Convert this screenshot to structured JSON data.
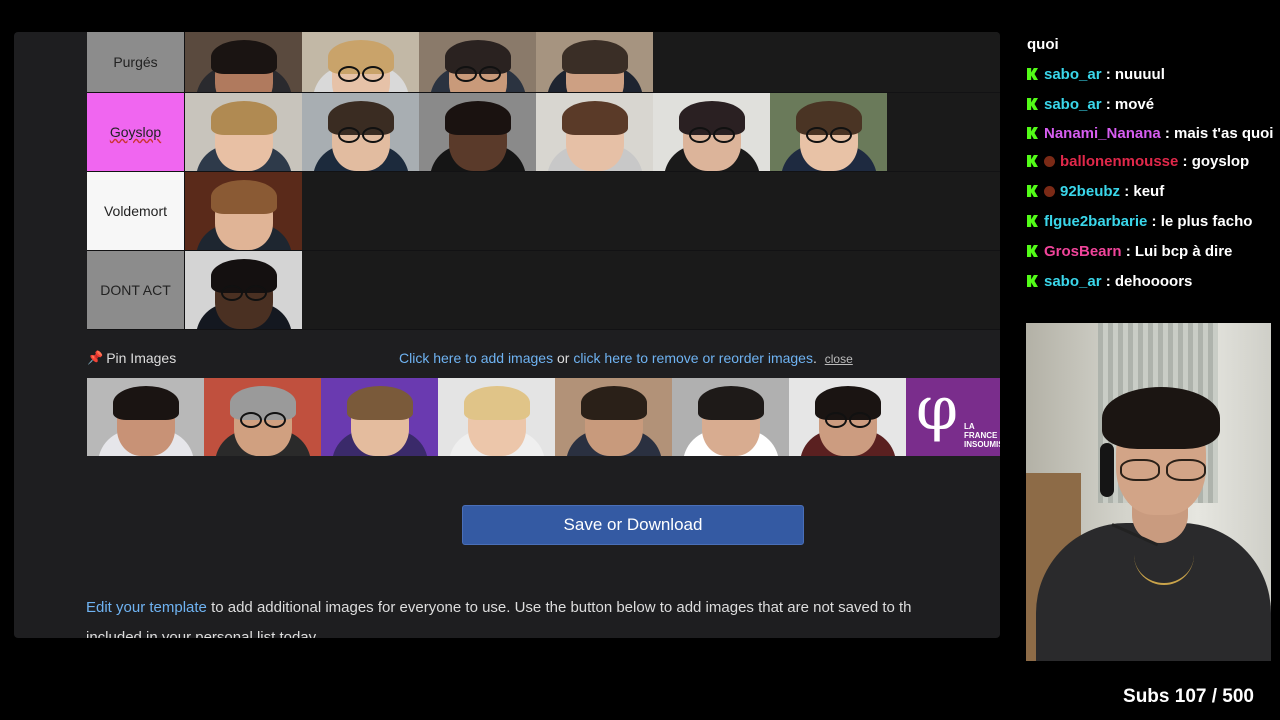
{
  "tiers": [
    {
      "label": "Purgés",
      "color": "#8c8c8c",
      "images": [
        {
          "skin": "#b07a5e",
          "hair": "#1a1412",
          "shirt": "#2a2a2e",
          "bg": "#5a4a3e",
          "glasses": false
        },
        {
          "skin": "#e6c2a8",
          "hair": "#c9a36a",
          "shirt": "#d9d9d9",
          "bg": "#c2b8a6",
          "glasses": true
        },
        {
          "skin": "#c99a7a",
          "hair": "#2a2220",
          "shirt": "#2b3340",
          "bg": "#8a7a6a",
          "glasses": true
        },
        {
          "skin": "#cda083",
          "hair": "#3a2e26",
          "shirt": "#1e2430",
          "bg": "#a69480",
          "glasses": false
        }
      ]
    },
    {
      "label": "Goyslop",
      "color": "#f066f0",
      "images": [
        {
          "skin": "#e8c0a4",
          "hair": "#b08a52",
          "shirt": "#2e3a4a",
          "bg": "#c8c4bc",
          "glasses": false
        },
        {
          "skin": "#e2bca0",
          "hair": "#3a2c22",
          "shirt": "#1c2a3c",
          "bg": "#a8aeb2",
          "glasses": true
        },
        {
          "skin": "#5a3a2a",
          "hair": "#1a1210",
          "shirt": "#151515",
          "bg": "#8a8a8a",
          "glasses": false
        },
        {
          "skin": "#e6c0a6",
          "hair": "#5a3a28",
          "shirt": "#c8c8c8",
          "bg": "#d8d6d0",
          "glasses": false
        },
        {
          "skin": "#dcb49a",
          "hair": "#2a2022",
          "shirt": "#1a1a1a",
          "bg": "#e0e0dc",
          "glasses": true
        },
        {
          "skin": "#e8c2a6",
          "hair": "#4a3424",
          "shirt": "#1e2a40",
          "bg": "#6a7a5a",
          "glasses": true
        }
      ]
    },
    {
      "label": "Voldemort",
      "color": "#f7f7f7",
      "images": [
        {
          "skin": "#e0b496",
          "hair": "#8a5a34",
          "shirt": "#1e2630",
          "bg": "#5a2a1a",
          "glasses": false
        }
      ]
    },
    {
      "label": "DONT ACT",
      "color": "#8c8c8c",
      "images": [
        {
          "skin": "#4a3022",
          "hair": "#141010",
          "shirt": "#141820",
          "bg": "#d4d4d4",
          "glasses": true
        }
      ]
    }
  ],
  "pin_bar": {
    "label": "Pin Images",
    "link_add": "Click here to add images",
    "or": "or",
    "link_remove": "click here to remove or reorder images",
    "period": ".",
    "close": "close"
  },
  "pinned_images": [
    {
      "skin": "#c89276",
      "hair": "#1a1412",
      "shirt": "#e6e6ea",
      "bg": "#b8b8b8",
      "glasses": false
    },
    {
      "skin": "#d0a080",
      "hair": "#9a9a9a",
      "shirt": "#2a2a2a",
      "bg": "#c0503e",
      "glasses": true
    },
    {
      "skin": "#e4bc9e",
      "hair": "#7a5a3a",
      "shirt": "#3a2a6a",
      "bg": "#6a3ab0",
      "glasses": false
    },
    {
      "skin": "#ecc6aa",
      "hair": "#e0c488",
      "shirt": "#efefef",
      "bg": "#e4e4e4",
      "glasses": false
    },
    {
      "skin": "#c89a7c",
      "hair": "#2a2018",
      "shirt": "#2a3040",
      "bg": "#b29278",
      "glasses": false
    },
    {
      "skin": "#d8ac90",
      "hair": "#1e1a18",
      "shirt": "#ffffff",
      "bg": "#b0b0b0",
      "glasses": false
    },
    {
      "skin": "#cc9c80",
      "hair": "#1a1412",
      "shirt": "#5a2020",
      "bg": "#e6e6e6",
      "glasses": true
    }
  ],
  "lfi_logo": {
    "symbol": "φ",
    "text_line1": "LA",
    "text_line2": "FRANCE",
    "text_line3": "INSOUMISE"
  },
  "save_button": "Save or Download",
  "info": {
    "link": "Edit your template",
    "text": " to add additional images for everyone to use. Use the button below to add images that are not saved to th",
    "text2": "included in your personal list today"
  },
  "chat": [
    {
      "user": "",
      "msg": "quoi",
      "continuation": true
    },
    {
      "user": "sabo_ar",
      "msg": ": nuuuul",
      "color": "#3ad6ea"
    },
    {
      "user": "sabo_ar",
      "msg": ": mové",
      "color": "#3ad6ea"
    },
    {
      "user": "Nanami_Nanana",
      "msg": ": mais t'as quoi",
      "color": "#d65df0",
      "wrap": true
    },
    {
      "user": "ballonenmousse",
      "msg": ": goyslop",
      "color": "#e0284a",
      "badge": true
    },
    {
      "user": "92beubz",
      "msg": ": keuf",
      "color": "#3ad6ea",
      "badge": true
    },
    {
      "user": "flgue2barbarie",
      "msg": ": le plus facho",
      "color": "#3ad6ea"
    },
    {
      "user": "GrosBearn",
      "msg": ": Lui bcp à dire",
      "color": "#f0449a"
    },
    {
      "user": "sabo_ar",
      "msg": ": dehoooors",
      "color": "#3ad6ea"
    }
  ],
  "subs": "Subs 107 / 500"
}
